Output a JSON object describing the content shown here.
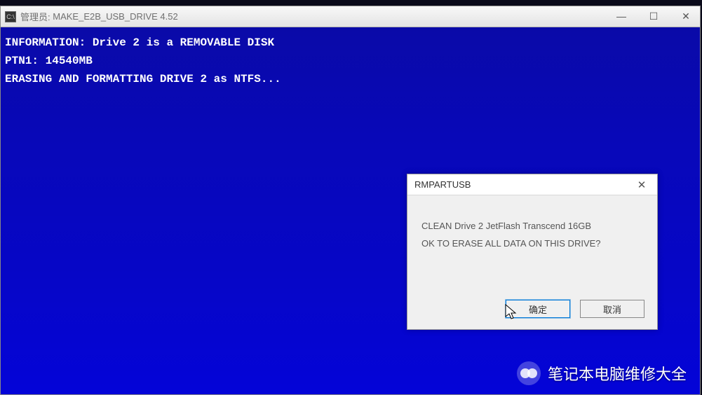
{
  "window": {
    "title_prefix": "管理员:",
    "title": "MAKE_E2B_USB_DRIVE 4.52",
    "controls": {
      "minimize": "—",
      "maximize": "☐",
      "close": "✕"
    }
  },
  "console": {
    "lines": [
      "INFORMATION: Drive 2 is a REMOVABLE DISK",
      "PTN1: 14540MB",
      "",
      "ERASING AND FORMATTING DRIVE 2 as NTFS..."
    ]
  },
  "dialog": {
    "title": "RMPARTUSB",
    "close": "✕",
    "line1": "CLEAN Drive 2   JetFlash Transcend 16GB",
    "line2": "OK TO ERASE ALL DATA ON THIS DRIVE?",
    "ok": "确定",
    "cancel": "取消"
  },
  "watermark": {
    "text": "笔记本电脑维修大全"
  }
}
